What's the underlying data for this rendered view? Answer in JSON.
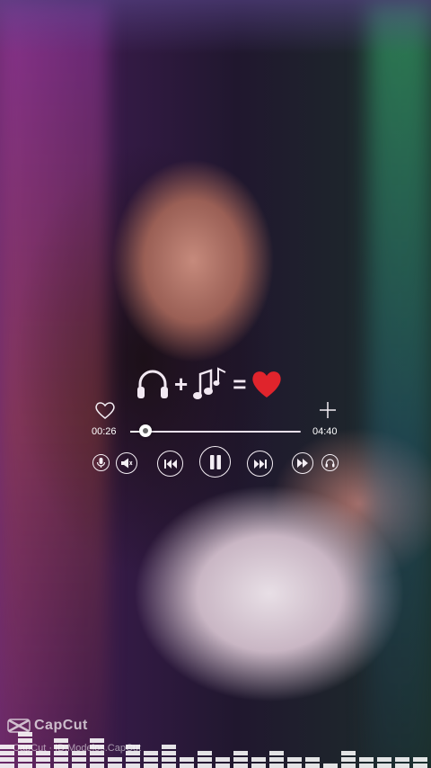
{
  "player": {
    "elapsed": "00:26",
    "total": "04:40",
    "progress_fraction": 0.09
  },
  "equation": {
    "plus": "+",
    "equals": "="
  },
  "icons": {
    "headphones": "headphones-icon",
    "notes": "music-notes-icon",
    "love": "heart-icon",
    "like": "heart-outline-icon",
    "add": "plus-icon",
    "mic": "microphone-icon",
    "volume": "speaker-icon",
    "prev": "skip-previous-icon",
    "pause": "pause-icon",
    "next": "skip-next-icon",
    "forward": "fast-forward-icon",
    "audio": "headset-icon"
  },
  "colors": {
    "heart": "#e0242c",
    "controls": "#f4eef4"
  },
  "watermark": {
    "logo": "CapCut",
    "caption": "CapCut · ID:Modelos.CapCut"
  },
  "equalizer_levels": [
    0.35,
    0.55,
    0.25,
    0.45,
    0.3,
    0.5,
    0.2,
    0.4,
    0.28,
    0.36,
    0.22,
    0.3,
    0.18,
    0.26,
    0.2,
    0.32,
    0.16,
    0.24,
    0.14,
    0.28,
    0.2,
    0.16,
    0.22,
    0.18
  ]
}
